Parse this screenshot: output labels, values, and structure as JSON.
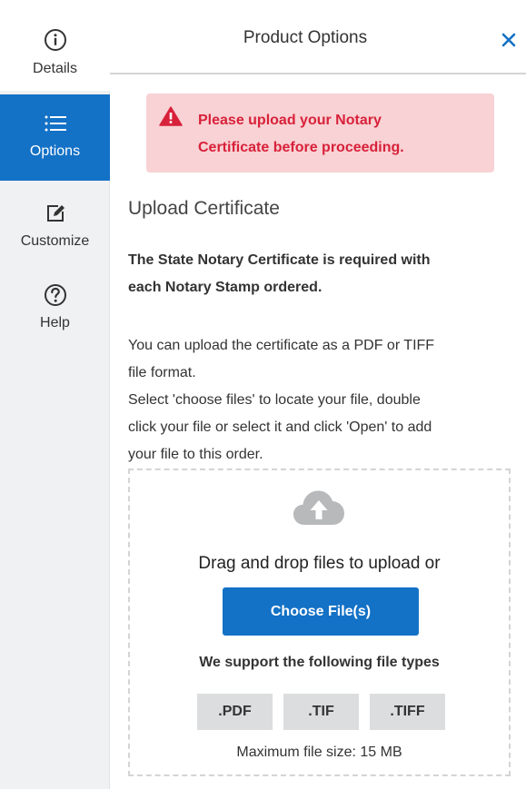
{
  "sidebar": {
    "items": [
      {
        "label": "Details",
        "icon": "info-icon"
      },
      {
        "label": "Options",
        "icon": "list-icon",
        "active": true
      },
      {
        "label": "Customize",
        "icon": "edit-icon"
      },
      {
        "label": "Help",
        "icon": "help-icon"
      }
    ]
  },
  "header": {
    "title": "Product Options",
    "close_icon": "close-icon"
  },
  "alert": {
    "icon": "warning-icon",
    "line1": "Please upload your Notary",
    "line2": "Certificate before proceeding."
  },
  "upload": {
    "section_title": "Upload Certificate",
    "required_line1": "The State Notary Certificate is required with",
    "required_line2": "each Notary Stamp ordered.",
    "instructions": [
      "You can upload the certificate as a PDF or TIFF",
      "file format.",
      "Select 'choose files' to locate your file, double",
      "click your file or select it and click 'Open' to add",
      "your file to this order."
    ],
    "dropzone": {
      "icon": "cloud-upload-icon",
      "drag_text": "Drag and drop files to upload or",
      "button_label": "Choose File(s)",
      "support_text": "We support the following file types",
      "file_types": [
        ".PDF",
        ".TIF",
        ".TIFF"
      ],
      "max_size": "Maximum file size: 15 MB"
    }
  },
  "colors": {
    "accent": "#1371c6",
    "alert_bg": "#f8d2d4",
    "alert_text": "#d8213a",
    "sidebar_bg": "#f0f1f2"
  }
}
